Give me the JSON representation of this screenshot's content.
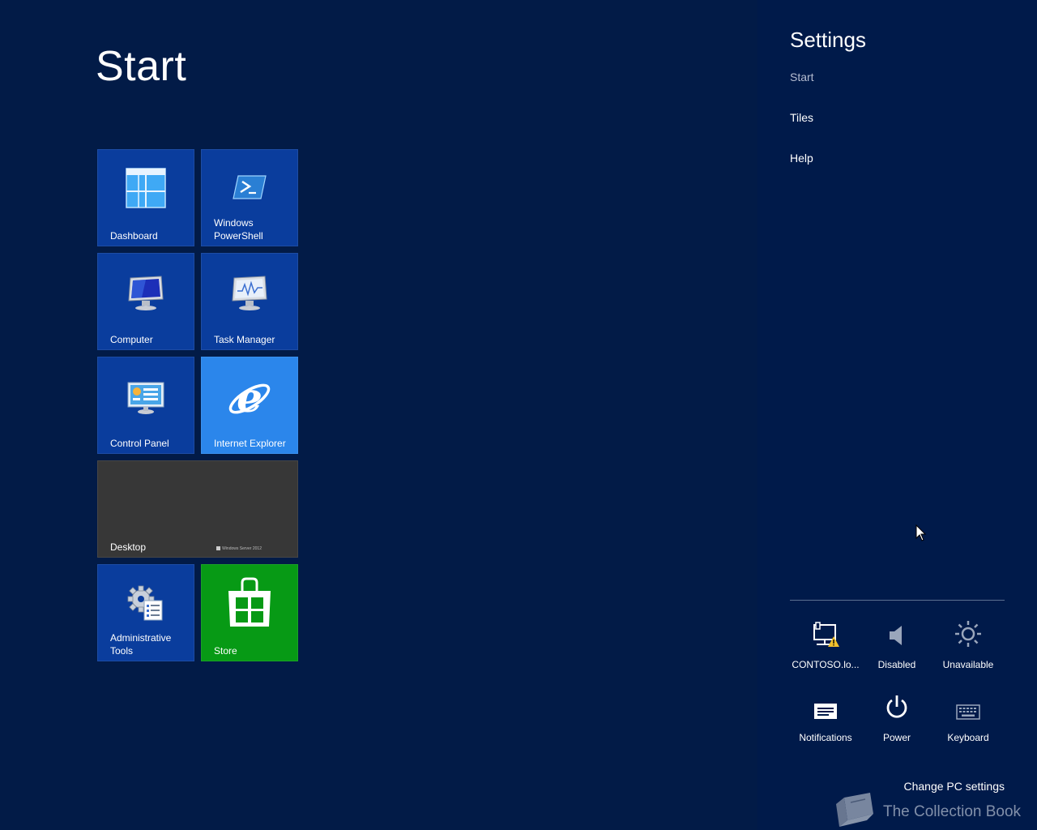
{
  "start": {
    "title": "Start"
  },
  "tiles": {
    "dashboard": "Dashboard",
    "powershell_line1": "Windows",
    "powershell_line2": "PowerShell",
    "computer": "Computer",
    "task_manager": "Task Manager",
    "control_panel": "Control Panel",
    "internet_explorer": "Internet Explorer",
    "desktop": "Desktop",
    "desktop_wallpaper_mark": "Windows Server 2012",
    "admin_tools_line1": "Administrative",
    "admin_tools_line2": "Tools",
    "store": "Store"
  },
  "colors": {
    "background": "#021b47",
    "charm_background": "#001a4a",
    "tile_blue": "#0a3d9d",
    "tile_ie": "#2b86eb",
    "tile_desktop": "#373737",
    "tile_store": "#079a15"
  },
  "charm": {
    "title": "Settings",
    "links": {
      "start": "Start",
      "tiles": "Tiles",
      "help": "Help"
    },
    "quick_settings": {
      "network": "CONTOSO.lo...",
      "volume": "Disabled",
      "brightness": "Unavailable",
      "notifications": "Notifications",
      "power": "Power",
      "keyboard": "Keyboard"
    },
    "change_pc_settings": "Change PC settings"
  },
  "watermark": {
    "text": "The Collection Book"
  },
  "icons": {
    "dashboard": "dashboard-grid-icon",
    "powershell": "powershell-prompt-icon",
    "computer": "computer-monitor-icon",
    "task_manager": "task-manager-monitor-icon",
    "control_panel": "control-panel-icon",
    "internet_explorer": "internet-explorer-e-icon",
    "admin_tools": "gear-checklist-icon",
    "store": "store-bag-icon",
    "network": "network-warning-icon",
    "volume": "speaker-icon",
    "brightness": "sun-icon",
    "notifications": "message-icon",
    "power": "power-icon",
    "keyboard": "keyboard-icon"
  }
}
